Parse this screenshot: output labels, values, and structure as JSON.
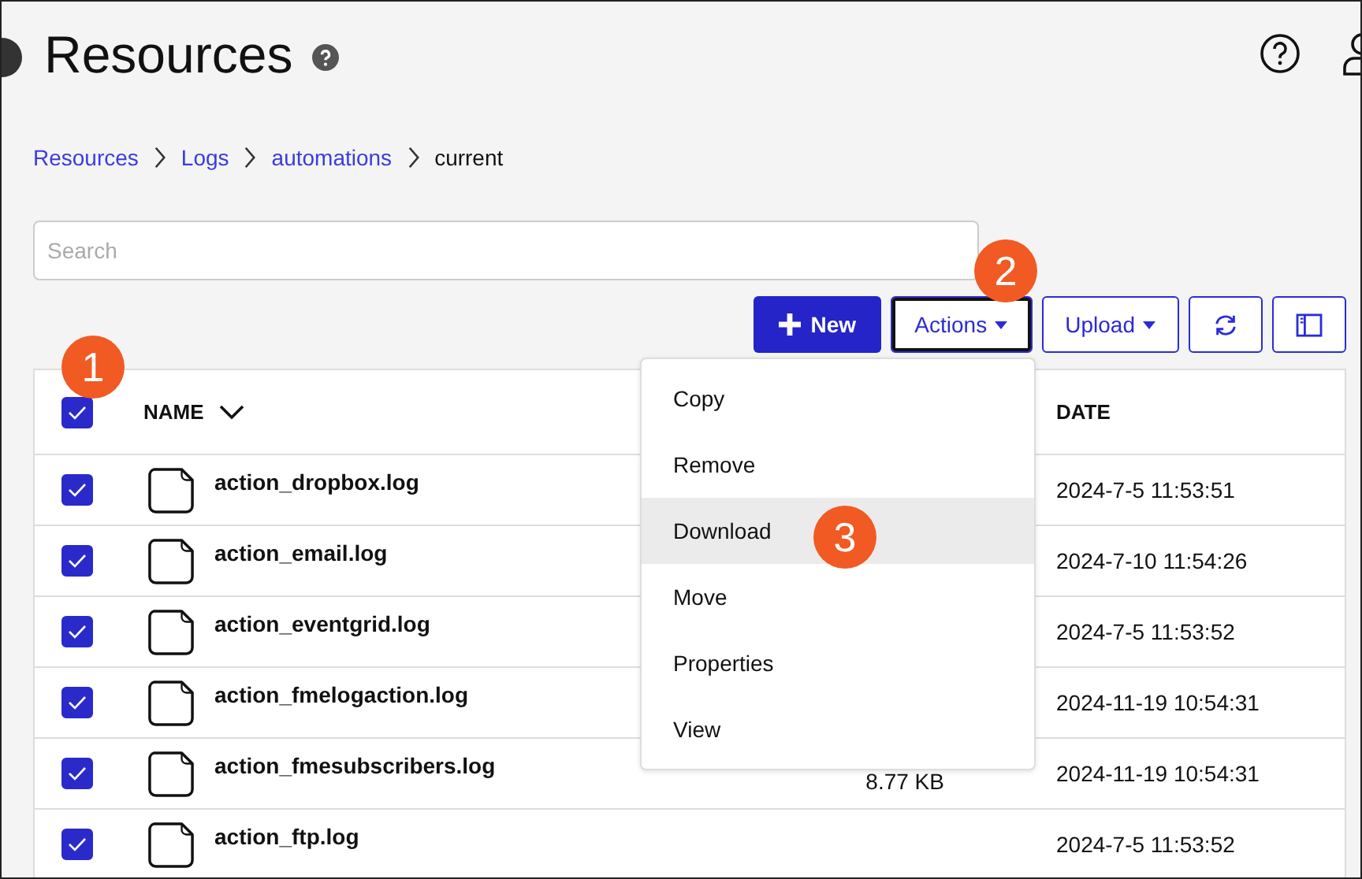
{
  "header": {
    "title": "Resources"
  },
  "breadcrumb": [
    "Resources",
    "Logs",
    "automations",
    "current"
  ],
  "search": {
    "placeholder": "Search"
  },
  "toolbar": {
    "new_label": "New",
    "actions_label": "Actions",
    "actions_focused": true,
    "upload_label": "Upload"
  },
  "table": {
    "select_all_checked": true,
    "columns": [
      "NAME",
      "DATE"
    ],
    "rows": [
      {
        "name": "action_dropbox.log",
        "date": "2024-7-5 11:53:51",
        "checked": true
      },
      {
        "name": "action_email.log",
        "date": "2024-7-10 11:54:26",
        "checked": true
      },
      {
        "name": "action_eventgrid.log",
        "date": "2024-7-5 11:53:52",
        "checked": true
      },
      {
        "name": "action_fmelogaction.log",
        "date": "2024-11-19 10:54:31",
        "checked": true
      },
      {
        "name": "action_fmesubscribers.log",
        "size": "8.77 KB",
        "date": "2024-11-19 10:54:31",
        "checked": true
      },
      {
        "name": "action_ftp.log",
        "date": "2024-7-5 11:53:52",
        "checked": true
      }
    ]
  },
  "actions_menu": [
    {
      "label": "Copy",
      "selected": false
    },
    {
      "label": "Remove",
      "selected": false
    },
    {
      "label": "Download",
      "selected": true
    },
    {
      "label": "Move",
      "selected": false
    },
    {
      "label": "Properties",
      "selected": false
    },
    {
      "label": "View",
      "selected": false
    }
  ],
  "callouts": [
    "1",
    "2",
    "3"
  ]
}
